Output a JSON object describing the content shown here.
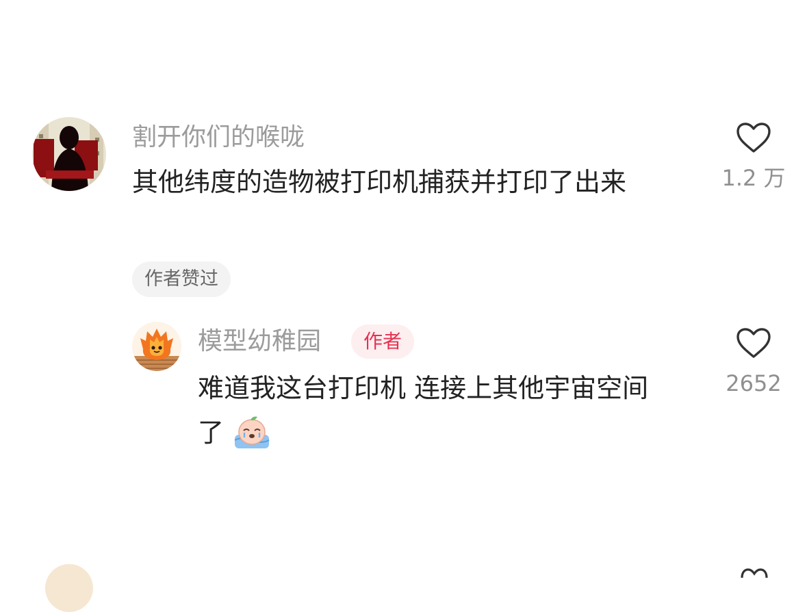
{
  "comment1": {
    "username": "割开你们的喉咙",
    "text": "其他纬度的造物被打印机捕获并打印了出来",
    "likes": "1.2 万",
    "avatar_icon": "dark-silhouette-avatar",
    "heart_icon": "heart-outline-icon"
  },
  "author_liked": {
    "label": "作者赞过"
  },
  "reply1": {
    "username": "模型幼稚园",
    "badge": "作者",
    "text_line1": "难道我这台打印机 连接上其他宇宙空间",
    "text_line2": "了",
    "emoji_icon": "crying-peach-emoji",
    "likes": "2652",
    "avatar_icon": "fire-spirit-avatar",
    "heart_icon": "heart-outline-icon"
  },
  "colors": {
    "username": "#9b9b9b",
    "text": "#222222",
    "badge_text": "#e63150",
    "badge_bg": "#fdeef0",
    "chip_bg": "#f3f3f3"
  }
}
